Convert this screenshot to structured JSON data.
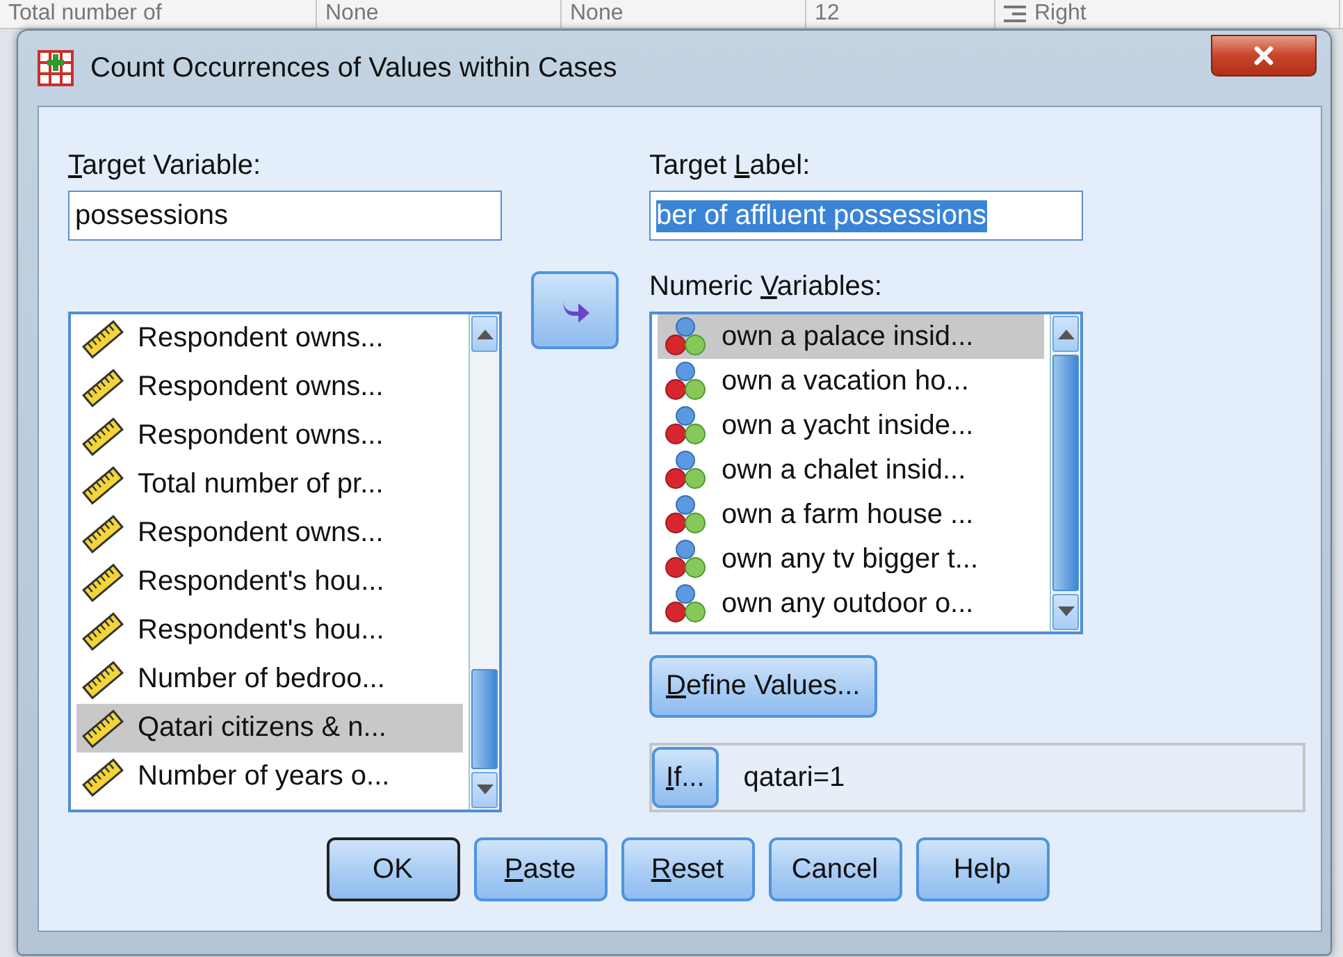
{
  "background_sheet": {
    "cells": [
      {
        "text": "Total number of",
        "kind": "text"
      },
      {
        "text": "None",
        "kind": "text"
      },
      {
        "text": "None",
        "kind": "text"
      },
      {
        "text": "12",
        "kind": "text"
      },
      {
        "text": "Right",
        "kind": "align"
      }
    ]
  },
  "window": {
    "title": "Count Occurrences of Values within Cases"
  },
  "target_variable": {
    "label": {
      "key": "T",
      "after": "arget Variable:"
    },
    "value": "possessions"
  },
  "target_label": {
    "label": {
      "before": "Target ",
      "key": "L",
      "after": "abel:"
    },
    "value": "ber of affluent possessions",
    "highlighted": true
  },
  "source_list": {
    "items": [
      {
        "label": "Respondent owns...",
        "kind": "scale",
        "selected": false
      },
      {
        "label": "Respondent owns...",
        "kind": "scale",
        "selected": false
      },
      {
        "label": "Respondent owns...",
        "kind": "scale",
        "selected": false
      },
      {
        "label": "Total number of pr...",
        "kind": "scale",
        "selected": false
      },
      {
        "label": "Respondent owns...",
        "kind": "scale",
        "selected": false
      },
      {
        "label": "Respondent's hou...",
        "kind": "scale",
        "selected": false
      },
      {
        "label": "Respondent's hou...",
        "kind": "scale",
        "selected": false
      },
      {
        "label": "Number of bedroo...",
        "kind": "scale",
        "selected": false
      },
      {
        "label": "Qatari citizens & n...",
        "kind": "scale",
        "selected": true
      },
      {
        "label": "Number of years o...",
        "kind": "scale",
        "selected": false
      }
    ]
  },
  "numeric_variables": {
    "label": {
      "before": "Numeric ",
      "key": "V",
      "after": "ariables:"
    },
    "items": [
      {
        "label": "own a palace insid...",
        "kind": "nominal",
        "selected": true
      },
      {
        "label": "own a vacation ho...",
        "kind": "nominal",
        "selected": false
      },
      {
        "label": "own a yacht inside...",
        "kind": "nominal",
        "selected": false
      },
      {
        "label": "own a chalet insid...",
        "kind": "nominal",
        "selected": false
      },
      {
        "label": "own a farm house ...",
        "kind": "nominal",
        "selected": false
      },
      {
        "label": "own any tv bigger t...",
        "kind": "nominal",
        "selected": false
      },
      {
        "label": "own any outdoor o...",
        "kind": "nominal",
        "selected": false
      }
    ]
  },
  "define_values_button": {
    "key": "D",
    "after": "efine Values..."
  },
  "if_condition": {
    "button": {
      "key": "I",
      "after": "f..."
    },
    "condition": "qatari=1"
  },
  "buttons": [
    {
      "label": {
        "after": "OK"
      },
      "default": true
    },
    {
      "label": {
        "key": "P",
        "after": "aste"
      },
      "default": false
    },
    {
      "label": {
        "key": "R",
        "after": "eset"
      },
      "default": false
    },
    {
      "label": {
        "after": "Cancel"
      },
      "default": false
    },
    {
      "label": {
        "after": "Help"
      },
      "default": false
    }
  ]
}
